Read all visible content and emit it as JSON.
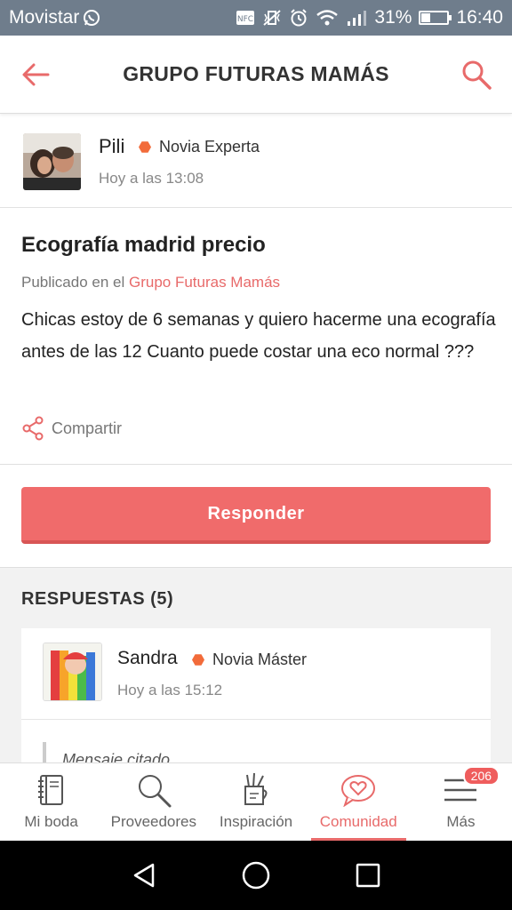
{
  "status_bar": {
    "carrier": "Movistar",
    "battery": "31%",
    "battery_level": 0.31,
    "time": "16:40",
    "icons": [
      "whatsapp-icon",
      "nfc-icon",
      "vibrate-icon",
      "alarm-icon",
      "wifi-icon",
      "signal-icon",
      "battery-icon"
    ]
  },
  "header": {
    "title": "GRUPO FUTURAS MAMÁS",
    "back_icon": "back-arrow-icon",
    "search_icon": "search-icon"
  },
  "post": {
    "author": {
      "name": "Pili",
      "badge": "Novia Experta",
      "time": "Hoy a las 13:08"
    },
    "title": "Ecografía madrid precio",
    "published_prefix": "Publicado en el ",
    "group_name": "Grupo Futuras Mamás",
    "body": "Chicas estoy de 6 semanas y quiero hacerme una ecografía antes de las 12 Cuanto puede costar una eco normal ???",
    "share_label": "Compartir"
  },
  "reply_button_label": "Responder",
  "answers": {
    "heading": "RESPUESTAS (5)",
    "items": [
      {
        "name": "Sandra",
        "badge": "Novia Máster",
        "time": "Hoy a las 15:12",
        "quote_label": "Mensaje citado"
      }
    ]
  },
  "bottom_nav": {
    "items": [
      {
        "label": "Mi boda",
        "icon": "notebook-icon"
      },
      {
        "label": "Proveedores",
        "icon": "magnifier-icon"
      },
      {
        "label": "Inspiración",
        "icon": "brushes-cup-icon"
      },
      {
        "label": "Comunidad",
        "icon": "heart-chat-icon",
        "active": true
      },
      {
        "label": "Más",
        "icon": "menu-icon",
        "badge": "206"
      }
    ]
  },
  "colors": {
    "accent": "#e86a6a",
    "button": "#f06b6b",
    "badge_dot": "#f26b3a",
    "status_bar": "#6f7d8c"
  }
}
